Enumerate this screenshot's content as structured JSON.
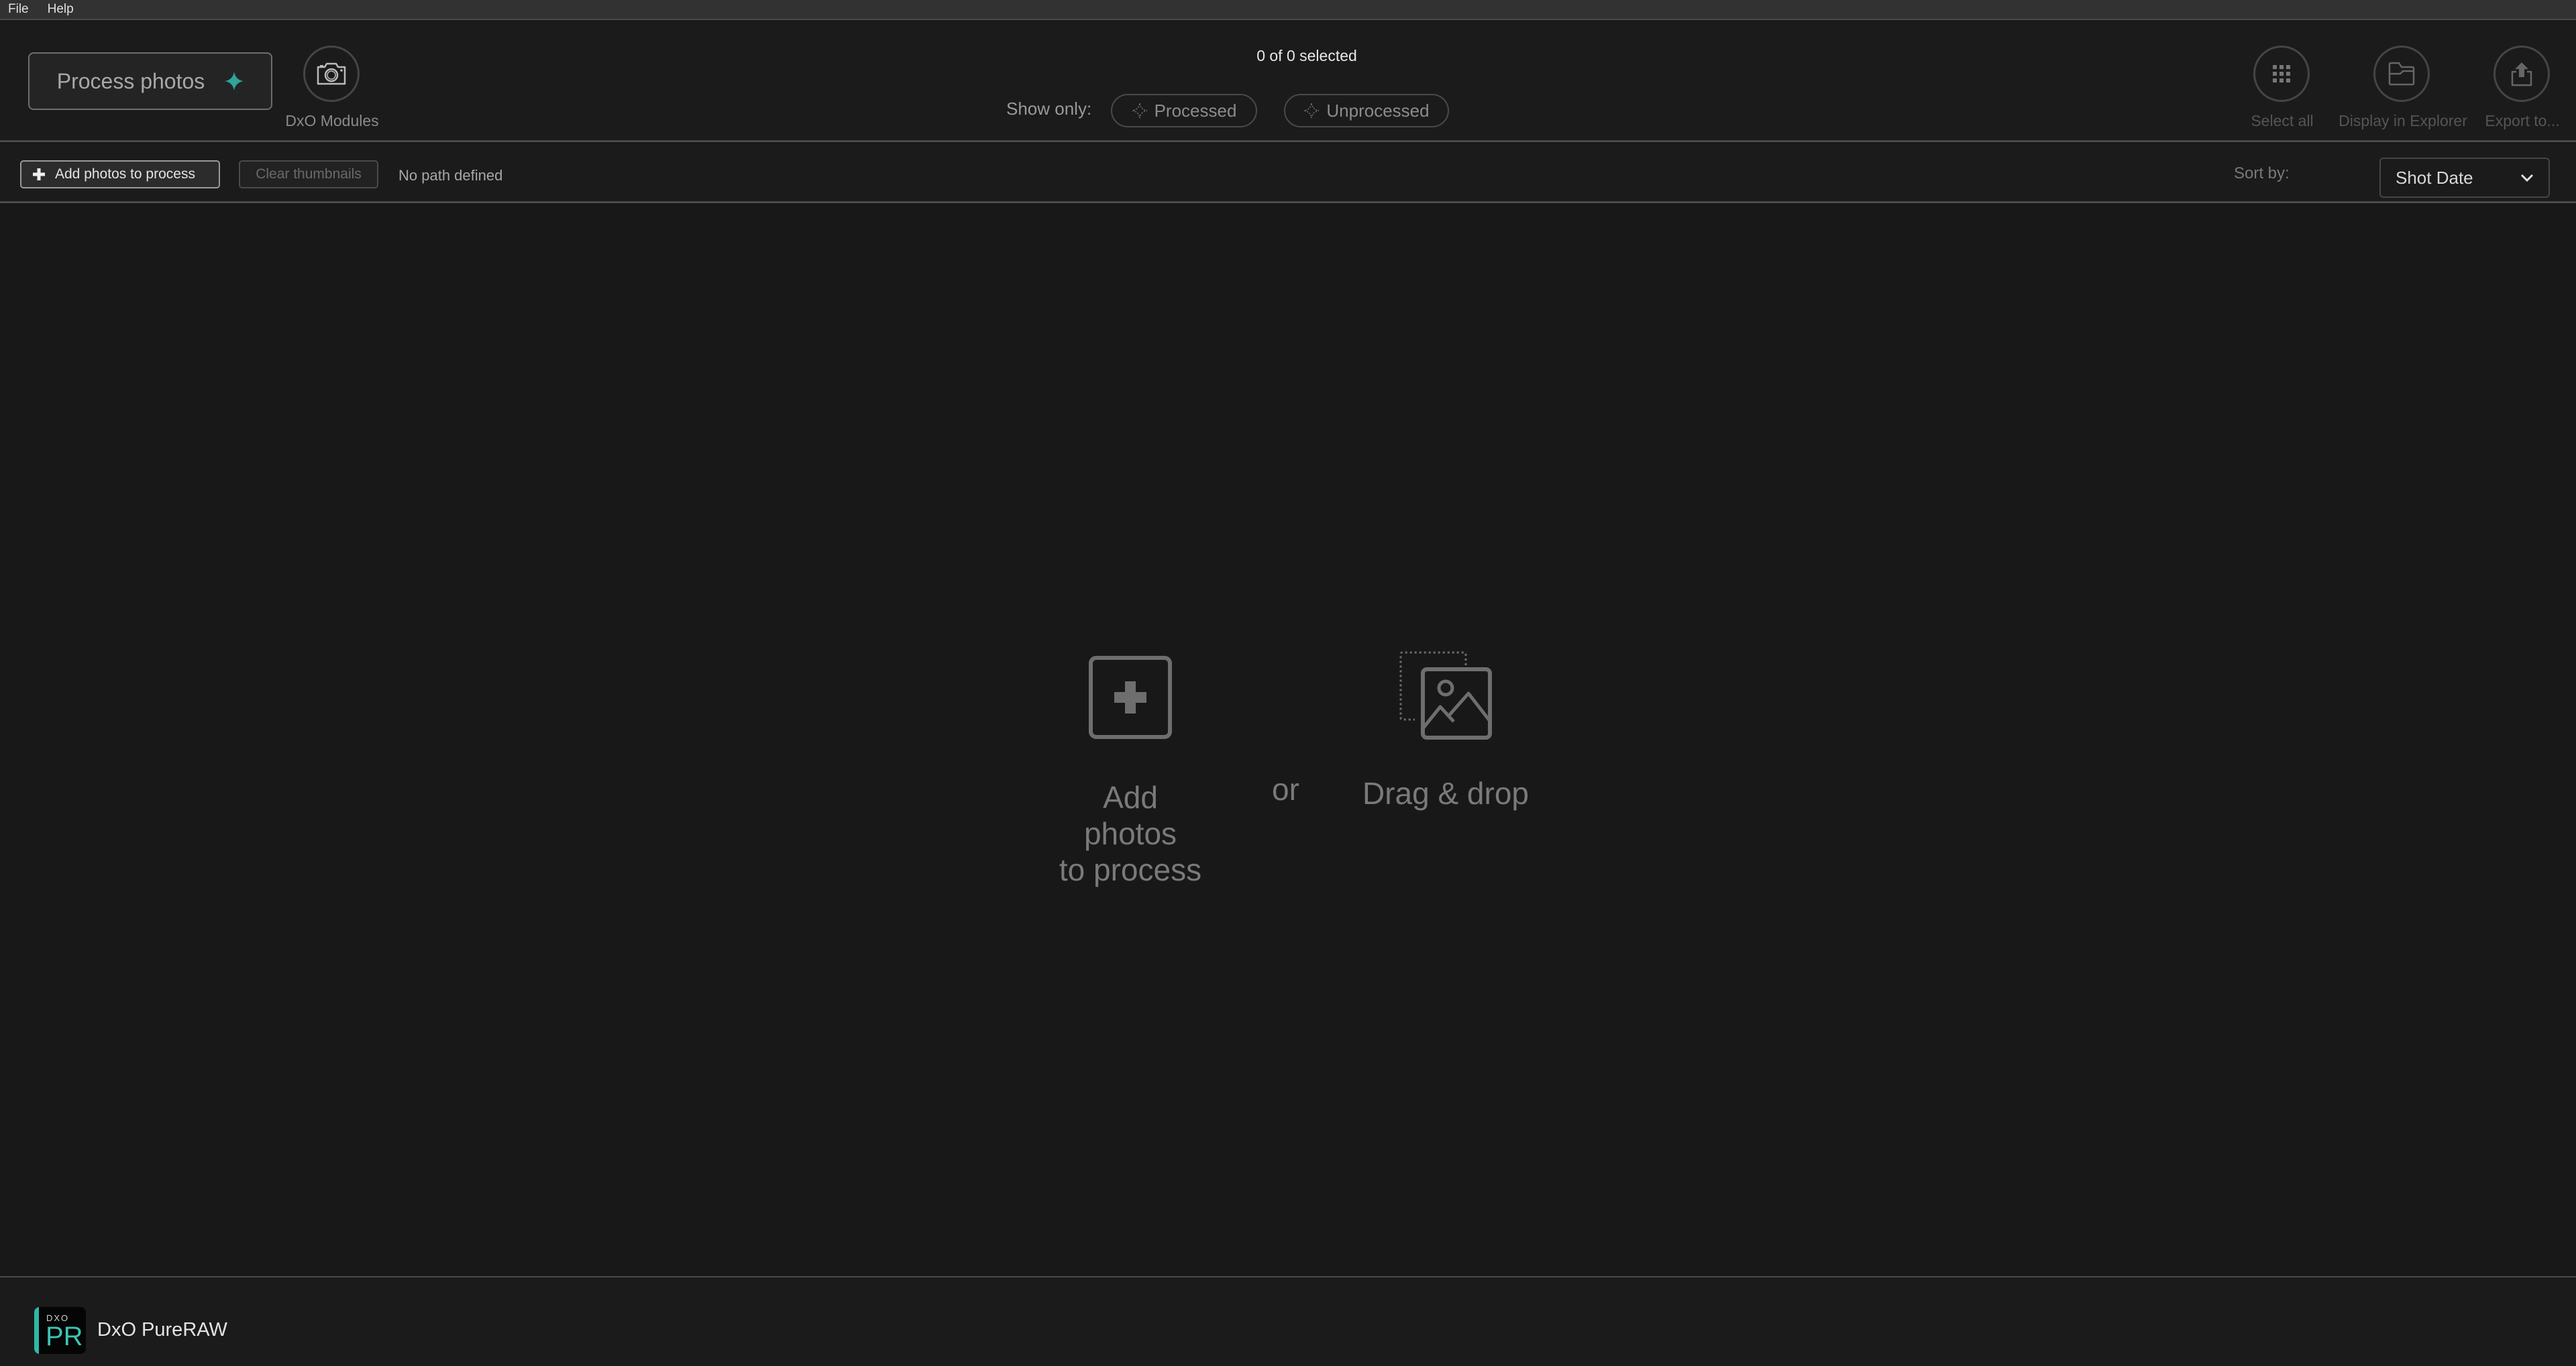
{
  "menu": {
    "items": [
      {
        "label": "File"
      },
      {
        "label": "Help"
      }
    ]
  },
  "header": {
    "process_button": {
      "label": "Process photos",
      "icon": "sparkle-icon"
    },
    "modules_button": {
      "label": "DxO Modules",
      "icon": "camera-icon"
    },
    "selected_count": "0 of 0 selected",
    "show_only": {
      "label": "Show only:",
      "filters": [
        {
          "label": "Processed",
          "icon": "sparkle-outline-icon"
        },
        {
          "label": "Unprocessed",
          "icon": "sparkle-outline-icon"
        }
      ]
    },
    "actions": [
      {
        "label": "Select all",
        "icon": "grid-icon"
      },
      {
        "label": "Display in Explorer",
        "icon": "folder-icon"
      },
      {
        "label": "Export to...",
        "icon": "export-icon"
      }
    ]
  },
  "toolbar": {
    "add_button": "Add photos to process",
    "clear_button": "Clear thumbnails",
    "path_text": "No path defined",
    "sort_label": "Sort by:",
    "sort_value": "Shot Date"
  },
  "empty_state": {
    "add_line1": "Add photos",
    "add_line2": "to process",
    "or": "or",
    "drag": "Drag & drop"
  },
  "footer": {
    "logo_top": "DXO",
    "logo_main": "PR",
    "app_name": "DxO PureRAW"
  },
  "colors": {
    "accent": "#2fb8a8",
    "background": "#181818",
    "panel": "#1b1b1b",
    "border": "#4a4a4a"
  }
}
